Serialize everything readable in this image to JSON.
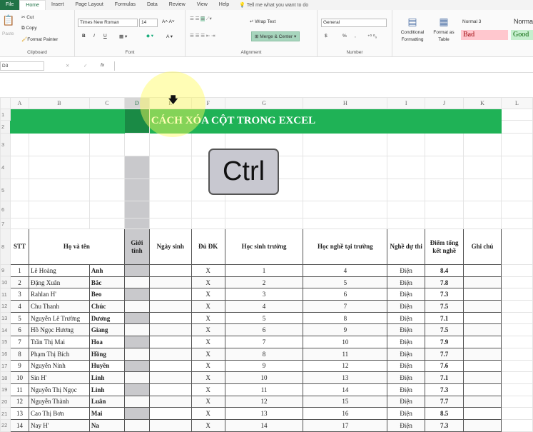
{
  "tabs": [
    "File",
    "Home",
    "Insert",
    "Page Layout",
    "Formulas",
    "Data",
    "Review",
    "View",
    "Help"
  ],
  "tell_me": "Tell me what you want to do",
  "ribbon": {
    "clipboard": {
      "paste": "Paste",
      "cut": "Cut",
      "copy": "Copy",
      "format_painter": "Format Painter",
      "label": "Clipboard"
    },
    "font": {
      "name": "Times New Roman",
      "size": "14",
      "bold": "B",
      "italic": "I",
      "underline": "U",
      "label": "Font"
    },
    "alignment": {
      "wrap": "Wrap Text",
      "merge": "Merge & Center",
      "label": "Alignment"
    },
    "number": {
      "format": "General",
      "currency": "$",
      "percent": "%",
      "comma": ",",
      "label": "Number"
    },
    "styles": {
      "conditional": "Conditional Formatting",
      "format_table": "Format as Table",
      "normal3": "Normal 3",
      "normal": "Norma",
      "bad": "Bad",
      "good": "Good"
    }
  },
  "formula_bar": {
    "name_box": "D3",
    "fx": "fx",
    "cancel": "✕",
    "enter": "✓"
  },
  "columns": [
    "A",
    "B",
    "C",
    "D",
    "E",
    "F",
    "G",
    "H",
    "I",
    "J",
    "K",
    "L"
  ],
  "row_numbers": [
    "1",
    "2",
    "3",
    "4",
    "5",
    "6",
    "7",
    "8",
    "9",
    "10",
    "11",
    "12",
    "13",
    "14",
    "15",
    "16",
    "17",
    "18",
    "19",
    "20",
    "21",
    "22"
  ],
  "title": "CÁCH XÓA CỘT TRONG EXCEL",
  "ctrl_key": "Ctrl",
  "headers": [
    "STT",
    "Họ và tên",
    "Giới tính",
    "Ngày sinh",
    "Đủ ĐK",
    "Học sinh trường",
    "Học nghề tại trường",
    "Nghề dự thi",
    "Điểm tổng kết nghề",
    "Ghi chú"
  ],
  "rows": [
    [
      "1",
      "Lê Hoàng",
      "Anh",
      "X",
      "1",
      "4",
      "Điện",
      "8.4"
    ],
    [
      "2",
      "Đặng Xuân",
      "Bắc",
      "X",
      "2",
      "5",
      "Điện",
      "7.8"
    ],
    [
      "3",
      "Rahlan H'",
      "Beo",
      "X",
      "3",
      "6",
      "Điện",
      "7.3"
    ],
    [
      "4",
      "Chu Thanh",
      "Chúc",
      "X",
      "4",
      "7",
      "Điện",
      "7.5"
    ],
    [
      "5",
      "Nguyễn Lê Trường",
      "Dương",
      "X",
      "5",
      "8",
      "Điện",
      "7.1"
    ],
    [
      "6",
      "Hồ Ngọc Hương",
      "Giang",
      "X",
      "6",
      "9",
      "Điện",
      "7.5"
    ],
    [
      "7",
      "Trần Thị Mai",
      "Hoa",
      "X",
      "7",
      "10",
      "Điện",
      "7.9"
    ],
    [
      "8",
      "Phạm Thị Bích",
      "Hồng",
      "X",
      "8",
      "11",
      "Điện",
      "7.7"
    ],
    [
      "9",
      "Nguyễn Ninh",
      "Huyền",
      "X",
      "9",
      "12",
      "Điện",
      "7.6"
    ],
    [
      "10",
      "Sin H'",
      "Linh",
      "X",
      "10",
      "13",
      "Điện",
      "7.1"
    ],
    [
      "11",
      "Nguyễn Thị Ngọc",
      "Linh",
      "X",
      "11",
      "14",
      "Điện",
      "7.3"
    ],
    [
      "12",
      "Nguyễn Thành",
      "Luân",
      "X",
      "12",
      "15",
      "Điện",
      "7.7"
    ],
    [
      "13",
      "Cao Thị Bơn",
      "Mai",
      "X",
      "13",
      "16",
      "Điện",
      "8.5"
    ],
    [
      "14",
      "Nay H'",
      "Na",
      "X",
      "14",
      "17",
      "Điện",
      "7.3"
    ]
  ]
}
